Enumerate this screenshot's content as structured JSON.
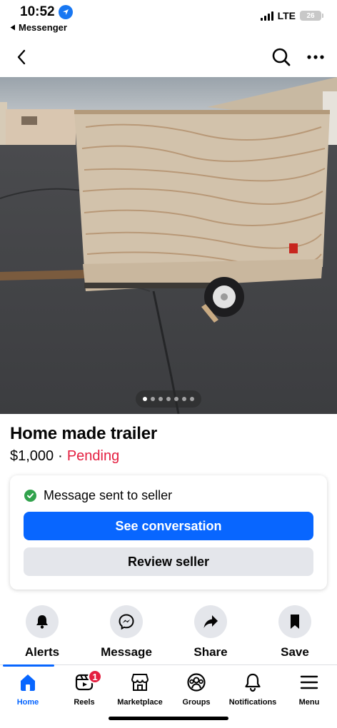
{
  "status_bar": {
    "time": "10:52",
    "back_app": "Messenger",
    "network": "LTE",
    "battery": "26"
  },
  "listing": {
    "title": "Home made trailer",
    "price": "$1,000",
    "separator": "·",
    "status": "Pending",
    "photo_count": 7,
    "active_photo_index": 0
  },
  "card": {
    "message": "Message sent to seller",
    "primary_button": "See conversation",
    "secondary_button": "Review seller"
  },
  "actions": [
    {
      "label": "Alerts",
      "icon": "bell-icon"
    },
    {
      "label": "Message",
      "icon": "messenger-icon"
    },
    {
      "label": "Share",
      "icon": "share-icon"
    },
    {
      "label": "Save",
      "icon": "bookmark-icon"
    }
  ],
  "tabs": [
    {
      "label": "Home",
      "icon": "home-icon",
      "active": true
    },
    {
      "label": "Reels",
      "icon": "reels-icon",
      "badge": "1"
    },
    {
      "label": "Marketplace",
      "icon": "marketplace-icon"
    },
    {
      "label": "Groups",
      "icon": "groups-icon"
    },
    {
      "label": "Notifications",
      "icon": "bell-icon"
    },
    {
      "label": "Menu",
      "icon": "menu-icon"
    }
  ],
  "colors": {
    "accent": "#0866ff",
    "pending": "#e41e3f",
    "success": "#31a24c",
    "secondary_button": "#e4e6eb"
  }
}
